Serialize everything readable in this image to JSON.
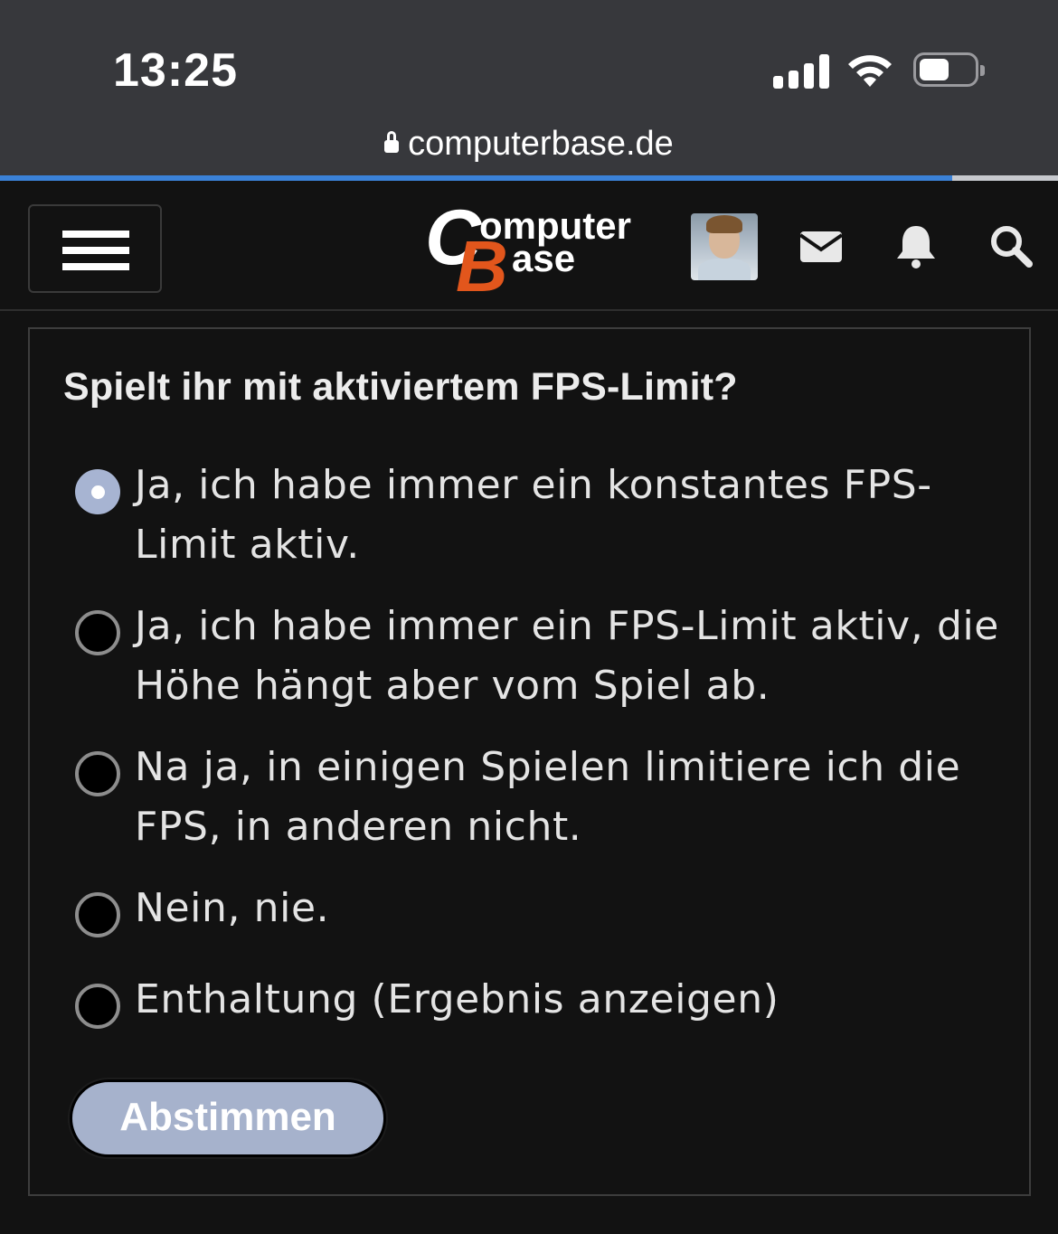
{
  "status_bar": {
    "time": "13:25",
    "url": "computerbase.de",
    "page_load_progress": 0.9
  },
  "header": {
    "logo_text_top": "omputer",
    "logo_text_bottom": "ase",
    "logo_letter_c": "C",
    "logo_letter_b": "B",
    "icons": [
      "menu-icon",
      "avatar",
      "mail-icon",
      "bell-icon",
      "search-icon"
    ],
    "colors": {
      "logo_orange": "#e2561c",
      "accent_blue": "#3b82d8"
    }
  },
  "poll": {
    "question": "Spielt ihr mit aktiviertem FPS-Limit?",
    "options": [
      {
        "line1": "Ja, ich habe immer ein konstantes FPS-",
        "line2": "Limit aktiv.",
        "selected": true
      },
      {
        "line1": "Ja, ich habe immer ein FPS-Limit aktiv, die",
        "line2": "Höhe hängt aber vom Spiel ab.",
        "selected": false
      },
      {
        "line1": "Na ja, in einigen Spielen limitiere ich die",
        "line2": "FPS, in anderen nicht.",
        "selected": false
      },
      {
        "line1": "Nein, nie.",
        "line2": "",
        "selected": false
      },
      {
        "line1": "Enthaltung (Ergebnis anzeigen)",
        "line2": "",
        "selected": false
      }
    ],
    "submit_label": "Abstimmen",
    "colors": {
      "radio_selected": "#a7b4d2",
      "button": "#a6b2cc"
    }
  }
}
